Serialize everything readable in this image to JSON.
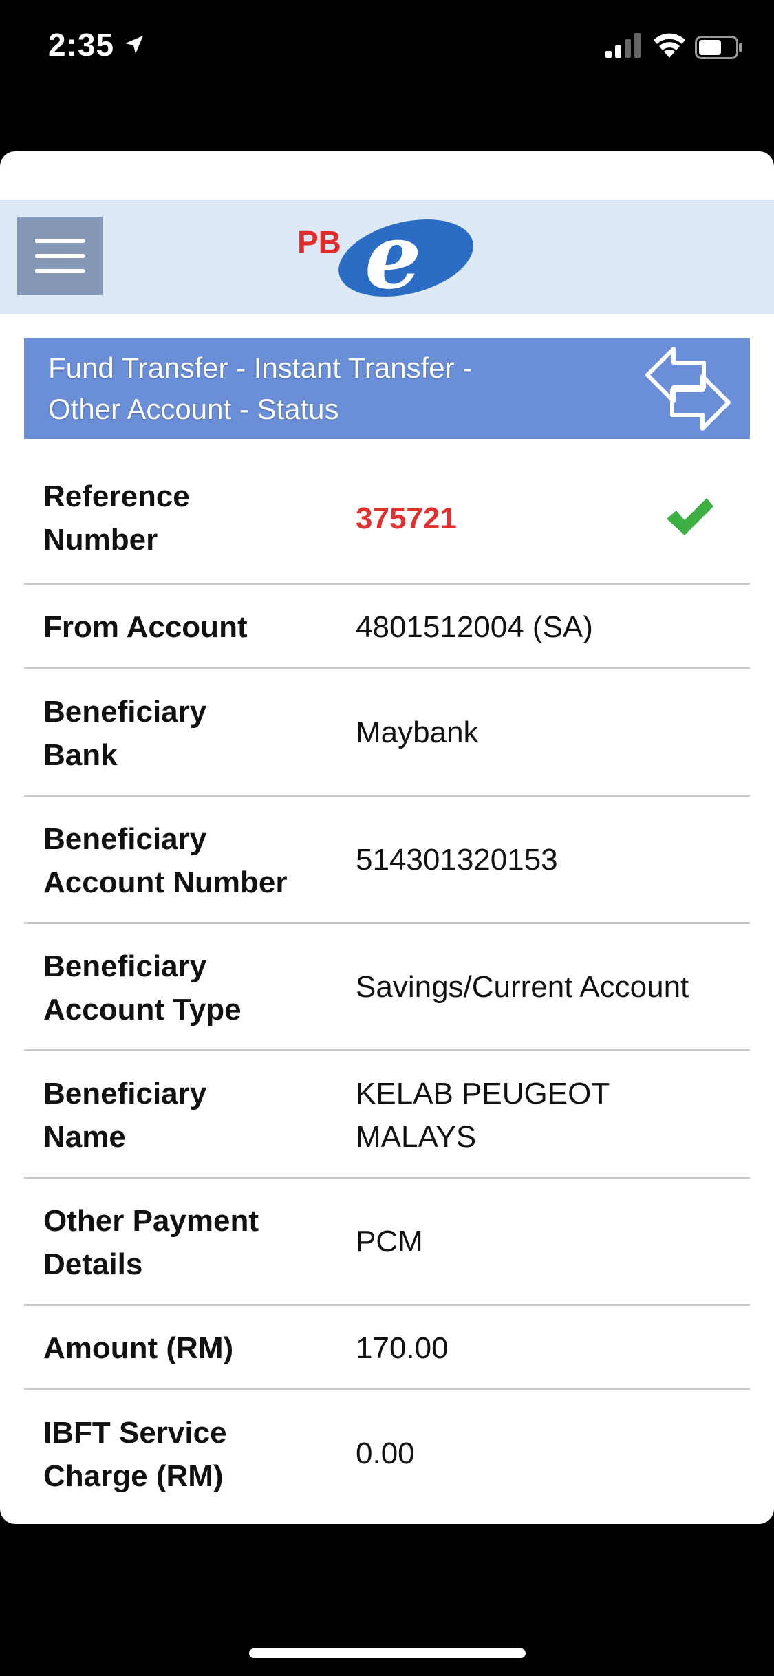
{
  "status_bar": {
    "time": "2:35"
  },
  "header": {
    "logo_text_pb": "PB",
    "logo_text_e": "e"
  },
  "title": {
    "line1": "Fund Transfer - Instant Transfer -",
    "line2": "Other Account - Status"
  },
  "details": [
    {
      "label": [
        "Reference",
        "Number"
      ],
      "value": [
        "375721"
      ]
    },
    {
      "label": [
        "From Account"
      ],
      "value": [
        "4801512004 (SA)"
      ]
    },
    {
      "label": [
        "Beneficiary",
        "Bank"
      ],
      "value": [
        "Maybank"
      ]
    },
    {
      "label": [
        "Beneficiary",
        "Account Number"
      ],
      "value": [
        "514301320153"
      ]
    },
    {
      "label": [
        "Beneficiary",
        "Account Type"
      ],
      "value": [
        "Savings/Current Account"
      ]
    },
    {
      "label": [
        "Beneficiary",
        "Name"
      ],
      "value": [
        "KELAB PEUGEOT",
        "MALAYS"
      ]
    },
    {
      "label": [
        "Other Payment",
        "Details"
      ],
      "value": [
        "PCM"
      ]
    },
    {
      "label": [
        "Amount (RM)"
      ],
      "value": [
        "170.00"
      ]
    },
    {
      "label": [
        "IBFT Service",
        "Charge (RM)"
      ],
      "value": [
        "0.00"
      ]
    }
  ],
  "colors": {
    "header_bg": "#dde9f5",
    "title_bg": "#6a8fd8",
    "reference": "#e03030",
    "check": "#3cb043",
    "logo_red": "#e42a2a",
    "logo_blue": "#2b6cc4"
  }
}
